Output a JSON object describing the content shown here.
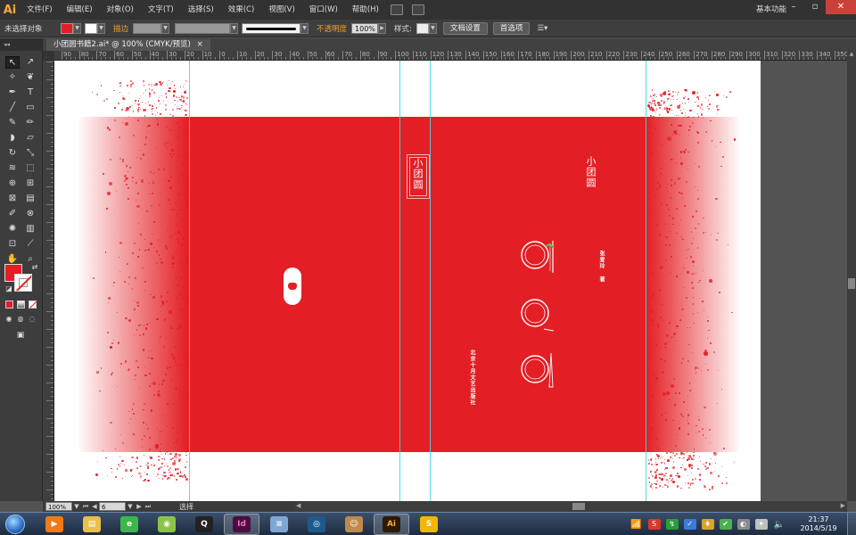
{
  "app": {
    "logo": "Ai",
    "workspace": "基本功能",
    "window_controls": {
      "minimize": "–",
      "maximize": "▫",
      "close": "✕"
    }
  },
  "menu": {
    "items": [
      "文件(F)",
      "编辑(E)",
      "对象(O)",
      "文字(T)",
      "选择(S)",
      "效果(C)",
      "视图(V)",
      "窗口(W)",
      "帮助(H)"
    ]
  },
  "controlbar": {
    "selection_label": "未选择对象",
    "stroke_label": "描边",
    "opacity_label": "不透明度",
    "opacity_value": "100%",
    "style_label": "样式:",
    "doc_settings_button": "文档设置",
    "preferences_button": "首选项",
    "fill_color": "#e31e24"
  },
  "document": {
    "tab_title": "小团圆书籍2.ai* @ 100% (CMYK/预览)",
    "tab_close": "×"
  },
  "ruler": {
    "labels": [
      "90",
      "80",
      "70",
      "60",
      "50",
      "40",
      "30",
      "20",
      "10",
      "0",
      "10",
      "20",
      "30",
      "40",
      "50",
      "60",
      "70",
      "80",
      "90",
      "100",
      "110",
      "120",
      "130",
      "140",
      "150",
      "160",
      "170",
      "180",
      "190",
      "200",
      "210",
      "220",
      "230",
      "240",
      "250",
      "260",
      "270",
      "280",
      "290",
      "300",
      "310",
      "320",
      "330",
      "340",
      "350",
      "36"
    ]
  },
  "cover": {
    "spine_title": "小团圆",
    "front_title": "小团圆",
    "author": "张爱玲 著",
    "publisher": "北京十月文艺出版社",
    "red": "#e31e24",
    "guide_color": "#3fd7e8"
  },
  "status": {
    "zoom": "100%",
    "artboard": "6",
    "label": "选择"
  },
  "taskbar": {
    "apps": [
      {
        "name": "media-player",
        "glyph": "▶",
        "color": "#f07a1a"
      },
      {
        "name": "file-explorer",
        "glyph": "▤",
        "color": "#e8c04a"
      },
      {
        "name": "browser-360",
        "glyph": "e",
        "color": "#3cb84a"
      },
      {
        "name": "media-center",
        "glyph": "◉",
        "color": "#8bc34a"
      },
      {
        "name": "qq",
        "glyph": "Q",
        "color": "#222"
      },
      {
        "name": "indesign",
        "glyph": "Id",
        "color": "#4b0f3f"
      },
      {
        "name": "notepad",
        "glyph": "≡",
        "color": "#7fa7d6"
      },
      {
        "name": "disc-burner",
        "glyph": "◎",
        "color": "#1c5a8c"
      },
      {
        "name": "users",
        "glyph": "☺",
        "color": "#c08a4a"
      },
      {
        "name": "illustrator",
        "glyph": "Ai",
        "color": "#2b1a05"
      },
      {
        "name": "sogou",
        "glyph": "S",
        "color": "#f2b705"
      }
    ],
    "clock_time": "21:37",
    "clock_date": "2014/5/19",
    "tray": [
      "S",
      "↯",
      "✓",
      "♦",
      "✔",
      "◐",
      "✦"
    ]
  }
}
